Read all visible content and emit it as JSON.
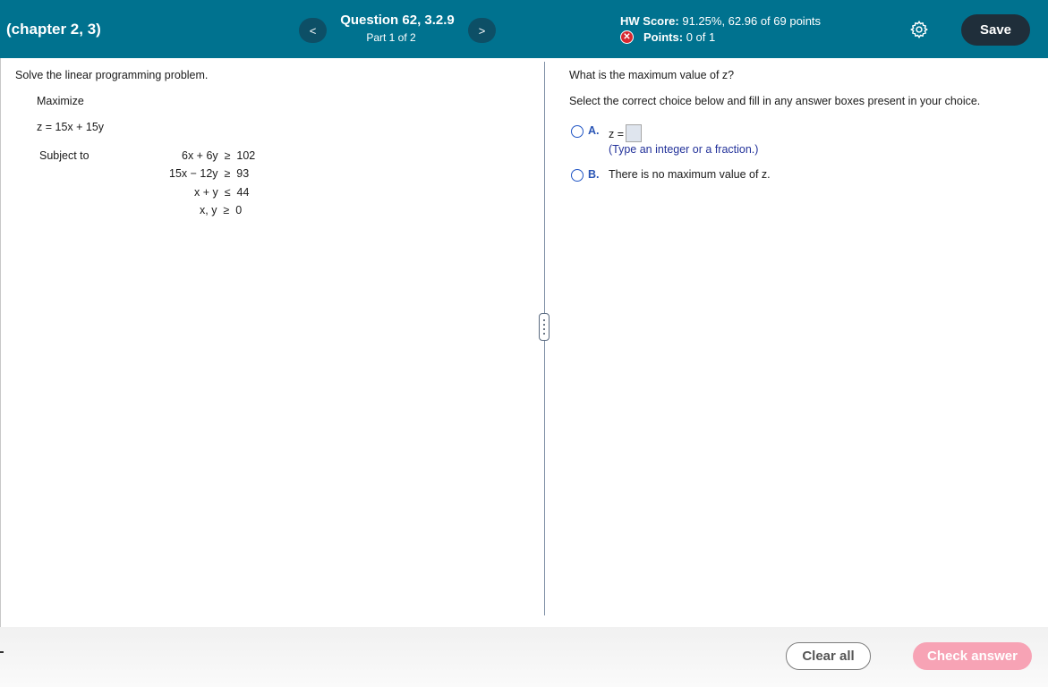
{
  "header": {
    "chapter_title": "(chapter 2, 3)",
    "prev_label": "<",
    "next_label": ">",
    "question_title": "Question 62, 3.2.9",
    "question_part": "Part 1 of 2",
    "hw_score_label": "HW Score:",
    "hw_score_value": "91.25%, 62.96 of 69 points",
    "points_label": "Points:",
    "points_value": "0 of 1",
    "save_label": "Save",
    "settings_icon": "gear-icon"
  },
  "left_panel": {
    "intro": "Solve the linear programming problem.",
    "objective_type": "Maximize",
    "objective": "z = 15x + 15y",
    "subject_to": "Subject to",
    "constraints": [
      "6x + 6y  ≥  102",
      "15x − 12y  ≥  93",
      "x + y  ≤  44",
      "x, y  ≥  0"
    ]
  },
  "right_panel": {
    "question": "What is the maximum value of z?",
    "instruction": "Select the correct choice below and fill in any answer boxes present in your choice.",
    "option_a_letter": "A.",
    "option_a_text": "z =",
    "option_a_hint": "(Type an integer or a fraction.)",
    "option_b_letter": "B.",
    "option_b_text": "There is no maximum value of z."
  },
  "footer": {
    "clear_label": "Clear all",
    "check_label": "Check answer"
  },
  "colors": {
    "header_bg": "#00728f",
    "save_bg": "#1f2e3a",
    "check_bg": "#f7a3b5",
    "radio_blue": "#2156c5",
    "error_red": "#d7272f"
  }
}
